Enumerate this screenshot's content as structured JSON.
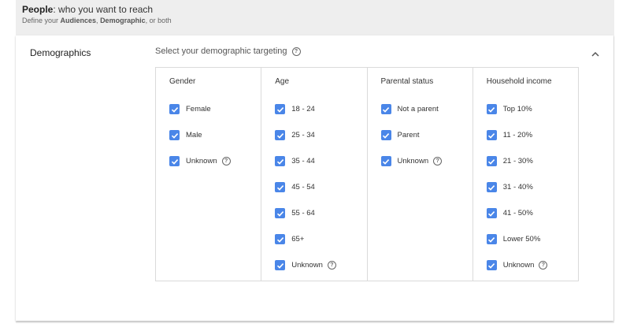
{
  "header": {
    "title_bold": "People",
    "title_rest": ": who you want to reach",
    "sub_prefix": "Define your ",
    "sub_audiences": "Audiences",
    "sub_sep": ", ",
    "sub_demographic": "Demographic",
    "sub_suffix": ", or both"
  },
  "section": {
    "title": "Demographics",
    "prompt": "Select your demographic targeting"
  },
  "columns": [
    {
      "header": "Gender",
      "options": [
        {
          "label": "Female",
          "checked": true,
          "help": false
        },
        {
          "label": "Male",
          "checked": true,
          "help": false
        },
        {
          "label": "Unknown",
          "checked": true,
          "help": true
        }
      ]
    },
    {
      "header": "Age",
      "options": [
        {
          "label": "18 - 24",
          "checked": true,
          "help": false
        },
        {
          "label": "25 - 34",
          "checked": true,
          "help": false
        },
        {
          "label": "35 - 44",
          "checked": true,
          "help": false
        },
        {
          "label": "45 - 54",
          "checked": true,
          "help": false
        },
        {
          "label": "55 - 64",
          "checked": true,
          "help": false
        },
        {
          "label": "65+",
          "checked": true,
          "help": false
        },
        {
          "label": "Unknown",
          "checked": true,
          "help": true
        }
      ]
    },
    {
      "header": "Parental status",
      "options": [
        {
          "label": "Not a parent",
          "checked": true,
          "help": false
        },
        {
          "label": "Parent",
          "checked": true,
          "help": false
        },
        {
          "label": "Unknown",
          "checked": true,
          "help": true
        }
      ]
    },
    {
      "header": "Household income",
      "options": [
        {
          "label": "Top 10%",
          "checked": true,
          "help": false
        },
        {
          "label": "11 - 20%",
          "checked": true,
          "help": false
        },
        {
          "label": "21 - 30%",
          "checked": true,
          "help": false
        },
        {
          "label": "31 - 40%",
          "checked": true,
          "help": false
        },
        {
          "label": "41 - 50%",
          "checked": true,
          "help": false
        },
        {
          "label": "Lower 50%",
          "checked": true,
          "help": false
        },
        {
          "label": "Unknown",
          "checked": true,
          "help": true
        }
      ]
    }
  ],
  "colors": {
    "checkbox": "#4a86e8",
    "border": "#dadada"
  }
}
